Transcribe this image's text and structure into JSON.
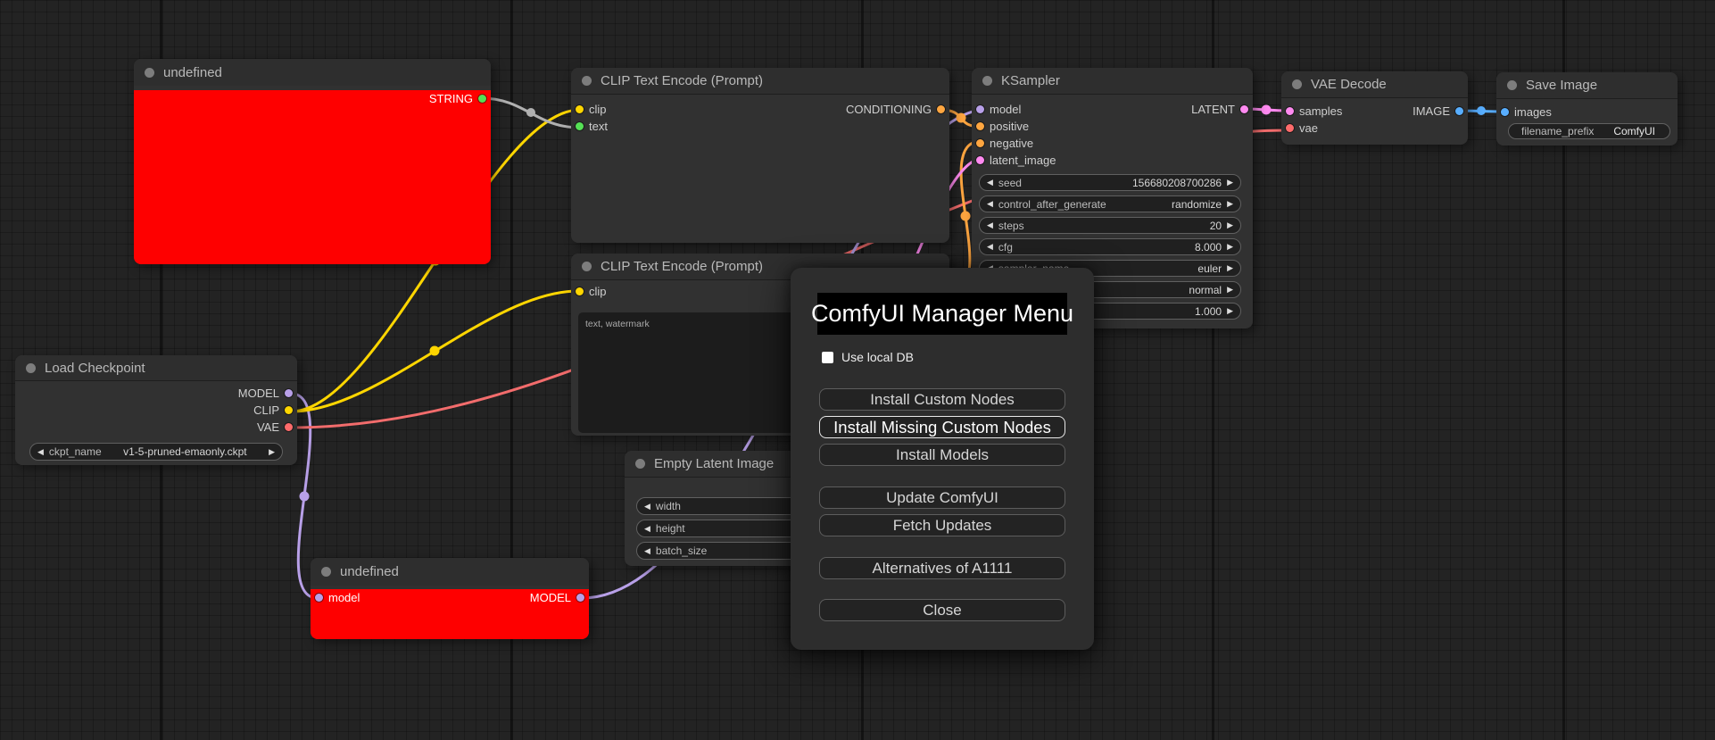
{
  "canvas": {
    "background": "#232323",
    "grid_line": "#1b1b1b"
  },
  "colors": {
    "model_slot": "#b8a0e8",
    "clip_slot": "#ffd600",
    "vae_slot": "#ff6b6b",
    "conditioning_slot": "#ffa640",
    "latent_slot": "#ff8af0",
    "image_slot": "#58aeff",
    "string_slot": "#55e055",
    "string_link": "#b0b0b0",
    "node_error_body": "#fe0000",
    "node_background": "#313131",
    "dialog_background": "#2d2d2d"
  },
  "nodes": {
    "undefined_top": {
      "title": "undefined",
      "output": "STRING"
    },
    "clip_encode_1": {
      "title": "CLIP Text Encode (Prompt)",
      "input_clip": "clip",
      "input_text": "text",
      "output": "CONDITIONING"
    },
    "clip_encode_2": {
      "title": "CLIP Text Encode (Prompt)",
      "input_clip": "clip",
      "text_value": "text, watermark"
    },
    "load_checkpoint": {
      "title": "Load Checkpoint",
      "outputs": [
        "MODEL",
        "CLIP",
        "VAE"
      ],
      "widget": {
        "label": "ckpt_name",
        "value": "v1-5-pruned-emaonly.ckpt"
      }
    },
    "empty_latent": {
      "title": "Empty Latent Image",
      "widgets": [
        {
          "label": "width",
          "value": ""
        },
        {
          "label": "height",
          "value": ""
        },
        {
          "label": "batch_size",
          "value": ""
        }
      ]
    },
    "ksampler": {
      "title": "KSampler",
      "inputs": [
        "model",
        "positive",
        "negative",
        "latent_image"
      ],
      "output": "LATENT",
      "widgets": [
        {
          "label": "seed",
          "value": "156680208700286"
        },
        {
          "label": "control_after_generate",
          "value": "randomize"
        },
        {
          "label": "steps",
          "value": "20"
        },
        {
          "label": "cfg",
          "value": "8.000"
        },
        {
          "label": "sampler_name",
          "value": "euler"
        },
        {
          "label": "",
          "value": "normal"
        },
        {
          "label": "",
          "value": "1.000"
        }
      ]
    },
    "vae_decode": {
      "title": "VAE Decode",
      "inputs": [
        "samples",
        "vae"
      ],
      "output": "IMAGE"
    },
    "save_image": {
      "title": "Save Image",
      "input": "images",
      "widget": {
        "label": "filename_prefix",
        "value": "ComfyUI"
      }
    },
    "undefined_bottom": {
      "title": "undefined",
      "input": "model",
      "output": "MODEL"
    }
  },
  "dialog": {
    "title": "ComfyUI Manager Menu",
    "checkbox_label": "Use local DB",
    "checkbox_checked": false,
    "buttons": [
      "Install Custom Nodes",
      "Install Missing Custom Nodes",
      "Install Models",
      "Update ComfyUI",
      "Fetch Updates",
      "Alternatives of A1111",
      "Close"
    ]
  }
}
